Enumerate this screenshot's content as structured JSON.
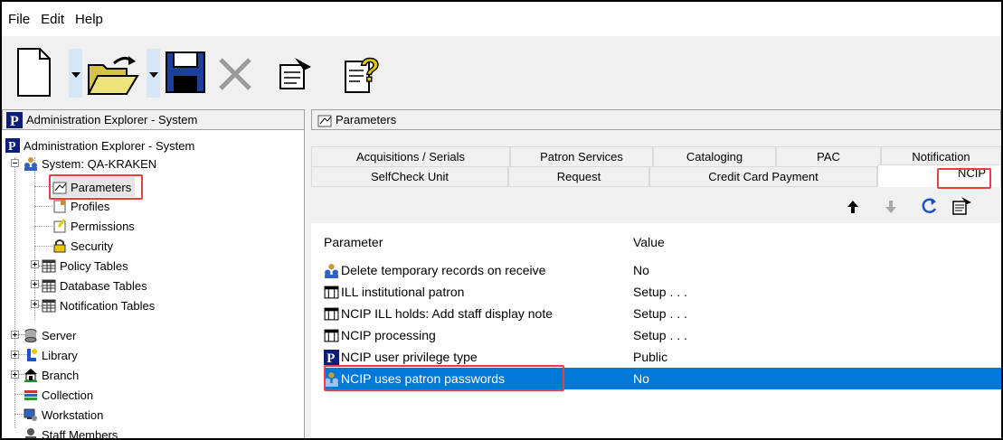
{
  "menu": [
    "File",
    "Edit",
    "Help"
  ],
  "toolbar": {
    "new_icon": "new-document-icon",
    "open_icon": "open-folder-icon",
    "save_icon": "save-icon",
    "delete_icon": "delete-x-icon",
    "properties_icon": "properties-icon",
    "whats_this_icon": "whats-this-help-icon"
  },
  "left_panel": {
    "title": "Administration Explorer - System"
  },
  "tree": {
    "root": "Administration Explorer - System",
    "system": "System: QA-KRAKEN",
    "parameters": "Parameters",
    "profiles": "Profiles",
    "permissions": "Permissions",
    "security": "Security",
    "policy_tables": "Policy Tables",
    "database_tables": "Database Tables",
    "notification_tables": "Notification Tables",
    "server": "Server",
    "library": "Library",
    "branch": "Branch",
    "collection": "Collection",
    "workstation": "Workstation",
    "staff_members": "Staff Members"
  },
  "right_panel": {
    "title": "Parameters"
  },
  "tabs": {
    "row1": [
      "Acquisitions / Serials",
      "Patron Services",
      "Cataloging",
      "PAC",
      "Notification"
    ],
    "row2": [
      "SelfCheck Unit",
      "Request",
      "Credit Card Payment",
      "NCIP"
    ],
    "active": "NCIP"
  },
  "grid": {
    "columns": [
      "Parameter",
      "Value"
    ],
    "rows": [
      {
        "icon": "users-icon",
        "parameter": "Delete temporary records on receive",
        "value": "No"
      },
      {
        "icon": "table-setup-icon",
        "parameter": "ILL institutional patron",
        "value": "Setup . . ."
      },
      {
        "icon": "table-setup-icon",
        "parameter": "NCIP ILL holds: Add staff display note",
        "value": "Setup . . ."
      },
      {
        "icon": "table-setup-icon",
        "parameter": "NCIP processing",
        "value": "Setup . . ."
      },
      {
        "icon": "polaris-p-icon",
        "parameter": "NCIP user privilege type",
        "value": "Public"
      },
      {
        "icon": "users-icon",
        "parameter": "NCIP uses patron passwords",
        "value": "No",
        "selected": true
      }
    ]
  },
  "colors": {
    "highlight": "#e8403c",
    "selection": "#0078d7"
  }
}
